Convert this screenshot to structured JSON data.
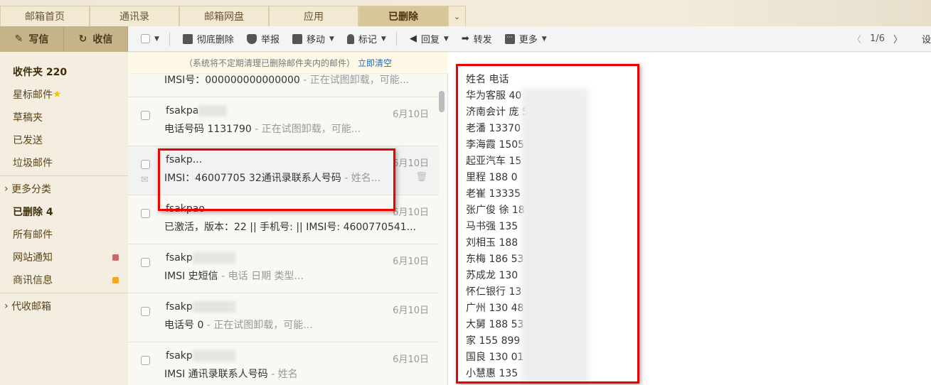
{
  "tabs": [
    "邮箱首页",
    "通讯录",
    "邮箱网盘",
    "应用",
    "已删除"
  ],
  "left_buttons": {
    "compose": "写信",
    "receive": "收信"
  },
  "toolbar": {
    "delete": "彻底删除",
    "report": "举报",
    "move": "移动",
    "mark": "标记",
    "reply": "回复",
    "forward": "转发",
    "more": "更多",
    "page": "1/6",
    "settings": "设"
  },
  "sidebar": [
    {
      "label": "收件夹 220",
      "bold": true
    },
    {
      "label": "星标邮件"
    },
    {
      "label": "草稿夹"
    },
    {
      "label": "已发送"
    },
    {
      "label": "垃圾邮件"
    },
    {
      "label": "更多分类"
    },
    {
      "label": "已删除 4",
      "bold": true
    },
    {
      "label": "所有邮件"
    },
    {
      "label": "网站通知",
      "dot": "#c86b6b"
    },
    {
      "label": "商讯信息",
      "dot": "#f5a623"
    },
    {
      "label": "代收邮箱"
    }
  ],
  "notice": {
    "text": "（系统将不定期清理已删除邮件夹内的邮件）",
    "link": "立即清空"
  },
  "emails": [
    {
      "from": "",
      "subject": "IMSI号：000000000000000",
      "preview": " - 正在试图卸载，可能...",
      "date": ""
    },
    {
      "from": "fsakpa",
      "subject": "电话号码 1131790",
      "preview": " - 正在试图卸载，可能...",
      "date": "6月10日"
    },
    {
      "from": "fsakp...",
      "subject": "IMSI：46007705 32通讯录联系人号码",
      "preview": " - 姓名...",
      "date": "6月10日"
    },
    {
      "from": "fsakpao",
      "subject": "已激活，版本：22 || 手机号: || IMSI号: 4600770541...",
      "preview": "",
      "date": "6月10日"
    },
    {
      "from": "fsakp",
      "subject": "IMSI 史短信",
      "preview": " - 电话 日期 类型...",
      "date": "6月10日"
    },
    {
      "from": "fsakp",
      "subject": "电话号 0",
      "preview": " - 正在试图卸载，可能...",
      "date": "6月10日"
    },
    {
      "from": "fsakp",
      "subject": "IMSI 通讯录联系人号码",
      "preview": " - 姓名",
      "date": "6月10日"
    }
  ],
  "contacts": [
    "姓名 电话",
    "华为客服 40",
    "济南会计 庞 56891567",
    "老潘 13370",
    "李海霞 1505",
    "起亚汽车 15",
    "里程 188 0",
    "老崔 13335",
    "张广俊 徐 18",
    "马书强 135",
    "刘相玉 188",
    "东梅 186 53",
    "苏成龙 130",
    "怀仁银行 13",
    "广州 130 48",
    "大舅 188 53",
    "家 155 899",
    "国良 130 01",
    "小慧惠 135"
  ]
}
